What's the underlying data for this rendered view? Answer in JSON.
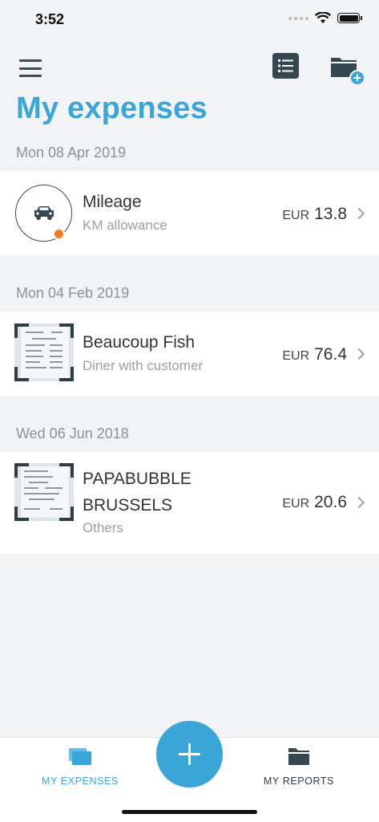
{
  "status_bar": {
    "time": "3:52"
  },
  "header": {
    "title": "My expenses"
  },
  "sections": [
    {
      "date": "Mon 08 Apr 2019",
      "item": {
        "title": "Mileage",
        "subtitle": "KM allowance",
        "currency": "EUR",
        "amount": "13.8",
        "icon": "car-icon"
      }
    },
    {
      "date": "Mon 04 Feb 2019",
      "item": {
        "title": "Beaucoup Fish",
        "subtitle": "Diner with customer",
        "currency": "EUR",
        "amount": "76.4",
        "icon": "receipt-thumbnail"
      }
    },
    {
      "date": "Wed 06 Jun 2018",
      "item": {
        "title_line1": "PAPABUBBLE",
        "title_line2": "BRUSSELS",
        "subtitle": "Others",
        "currency": "EUR",
        "amount": "20.6",
        "icon": "receipt-thumbnail"
      }
    }
  ],
  "tabs": [
    {
      "label": "MY EXPENSES",
      "icon": "expenses-cards-icon",
      "active": true
    },
    {
      "label": "MY REPORTS",
      "icon": "folder-icon",
      "active": false
    }
  ],
  "fab": {
    "icon": "plus-icon"
  },
  "colors": {
    "accent": "#3aa6d8",
    "dark": "#354750",
    "badge": "#f07e1f",
    "background": "#f2f3f5"
  }
}
